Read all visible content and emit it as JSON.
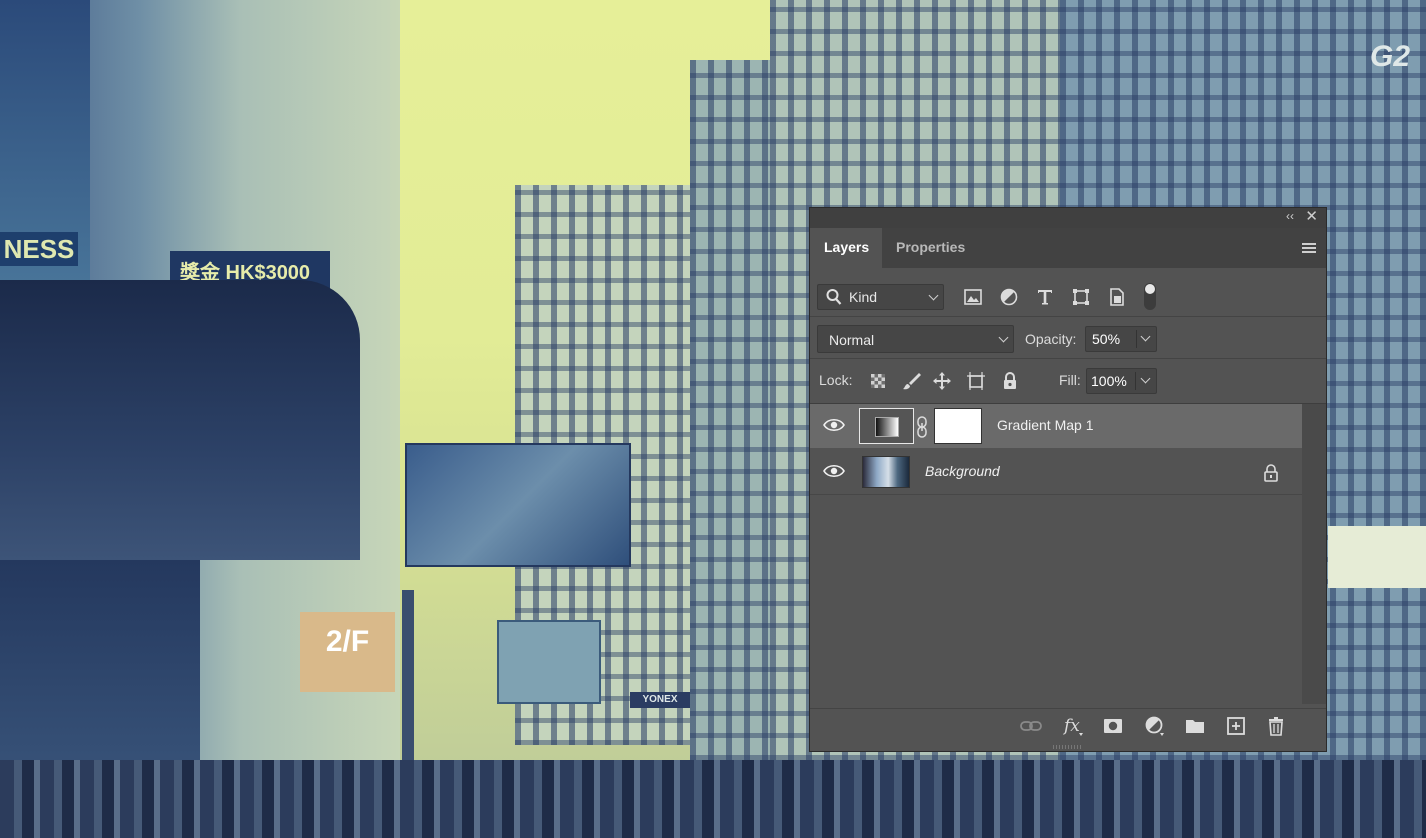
{
  "panel": {
    "tabs": [
      {
        "label": "Layers",
        "active": true
      },
      {
        "label": "Properties",
        "active": false
      }
    ],
    "collapse_glyph": "‹‹",
    "close_glyph": "✕",
    "filter": {
      "kind_label": "Kind",
      "icons": [
        "image-filter-icon",
        "adjustment-filter-icon",
        "type-filter-icon",
        "shape-filter-icon",
        "smart-object-filter-icon"
      ]
    },
    "blend_mode": "Normal",
    "opacity_label": "Opacity:",
    "opacity_value": "50%",
    "lock_label": "Lock:",
    "fill_label": "Fill:",
    "fill_value": "100%",
    "layers": [
      {
        "name": "Gradient Map 1",
        "visible": true,
        "selected": true,
        "type": "adjustment"
      },
      {
        "name": "Background",
        "visible": true,
        "selected": false,
        "locked": true,
        "type": "pixel"
      }
    ]
  },
  "background_signs": {
    "prize": "獎金 HK$3000",
    "fitness": "NESS",
    "floor_sign": "2/F",
    "yonex": "YONEX",
    "g2": "G2"
  },
  "colors": {
    "panel_bg": "#535353",
    "selected_row": "#6a6a6a",
    "sky": "#e4ee98",
    "building_tone": "#7f9aa8"
  }
}
